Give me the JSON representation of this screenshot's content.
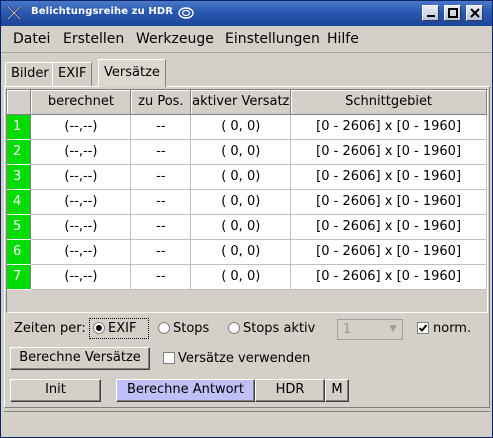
{
  "window": {
    "title": "Belichtungsreihe zu HDR"
  },
  "menu": [
    "Datei",
    "Erstellen",
    "Werkzeuge",
    "Einstellungen",
    "Hilfe"
  ],
  "tabs": [
    "Bilder",
    "EXIF",
    "Versätze"
  ],
  "active_tab": "Versätze",
  "table": {
    "headers": [
      "",
      "berechnet",
      "zu Pos.",
      "aktiver Versatz",
      "Schnittgebiet"
    ],
    "rows": [
      {
        "num": "1",
        "berechnet": "(--,--)",
        "zu_pos": "--",
        "aktiver_versatz": "( 0, 0)",
        "schnittgebiet": "[0 - 2606]  x  [0 - 1960]"
      },
      {
        "num": "2",
        "berechnet": "(--,--)",
        "zu_pos": "--",
        "aktiver_versatz": "( 0, 0)",
        "schnittgebiet": "[0 - 2606]  x  [0 - 1960]"
      },
      {
        "num": "3",
        "berechnet": "(--,--)",
        "zu_pos": "--",
        "aktiver_versatz": "( 0, 0)",
        "schnittgebiet": "[0 - 2606]  x  [0 - 1960]"
      },
      {
        "num": "4",
        "berechnet": "(--,--)",
        "zu_pos": "--",
        "aktiver_versatz": "( 0, 0)",
        "schnittgebiet": "[0 - 2606]  x  [0 - 1960]"
      },
      {
        "num": "5",
        "berechnet": "(--,--)",
        "zu_pos": "--",
        "aktiver_versatz": "( 0, 0)",
        "schnittgebiet": "[0 - 2606]  x  [0 - 1960]"
      },
      {
        "num": "6",
        "berechnet": "(--,--)",
        "zu_pos": "--",
        "aktiver_versatz": "( 0, 0)",
        "schnittgebiet": "[0 - 2606]  x  [0 - 1960]"
      },
      {
        "num": "7",
        "berechnet": "(--,--)",
        "zu_pos": "--",
        "aktiver_versatz": "( 0, 0)",
        "schnittgebiet": "[0 - 2606]  x  [0 - 1960]"
      }
    ],
    "row_number_color": "#00dc00"
  },
  "zeiten": {
    "label": "Zeiten per:",
    "options": [
      "EXIF",
      "Stops",
      "Stops aktiv"
    ],
    "selected": "EXIF",
    "stops_value": "1",
    "norm_label": "norm.",
    "norm_checked": true
  },
  "offsets": {
    "compute_button": "Berechne Versätze",
    "use_checkbox_label": "Versätze verwenden",
    "use_checked": false
  },
  "buttons": {
    "init": "Init",
    "compute_response": "Berechne Antwort",
    "hdr": "HDR",
    "m": "M"
  },
  "colors": {
    "titlebar": "#2a58b0",
    "highlight_button": "#c0c0f8"
  },
  "icons": [
    "app-icon",
    "kde-swirl-icon",
    "minimize-icon",
    "maximize-icon",
    "close-icon",
    "dropdown-arrow-icon",
    "checkmark-icon"
  ]
}
